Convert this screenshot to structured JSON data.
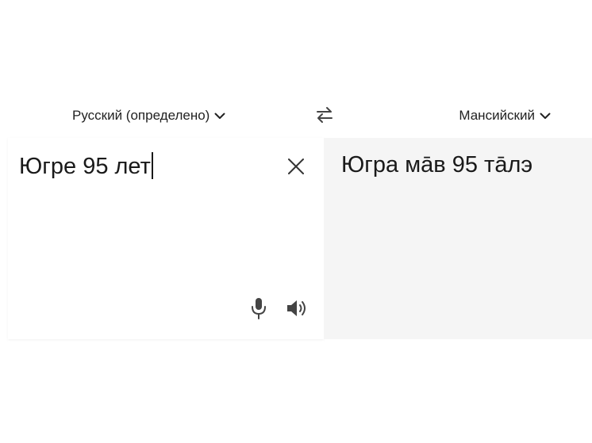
{
  "languages": {
    "source_label": "Русский (определено)",
    "target_label": "Мансийский"
  },
  "source": {
    "text": "Югре 95 лет"
  },
  "target": {
    "text": "Югра мāв 95 тāлэ"
  },
  "icons": {
    "source_dropdown": "chevron-down-icon",
    "target_dropdown": "chevron-down-icon",
    "swap": "swap-icon",
    "clear": "close-icon",
    "mic": "microphone-icon",
    "speaker": "speaker-icon"
  },
  "colors": {
    "text": "#1a1a1a",
    "target_panel_bg": "#f5f5f5",
    "icon": "#444444"
  }
}
